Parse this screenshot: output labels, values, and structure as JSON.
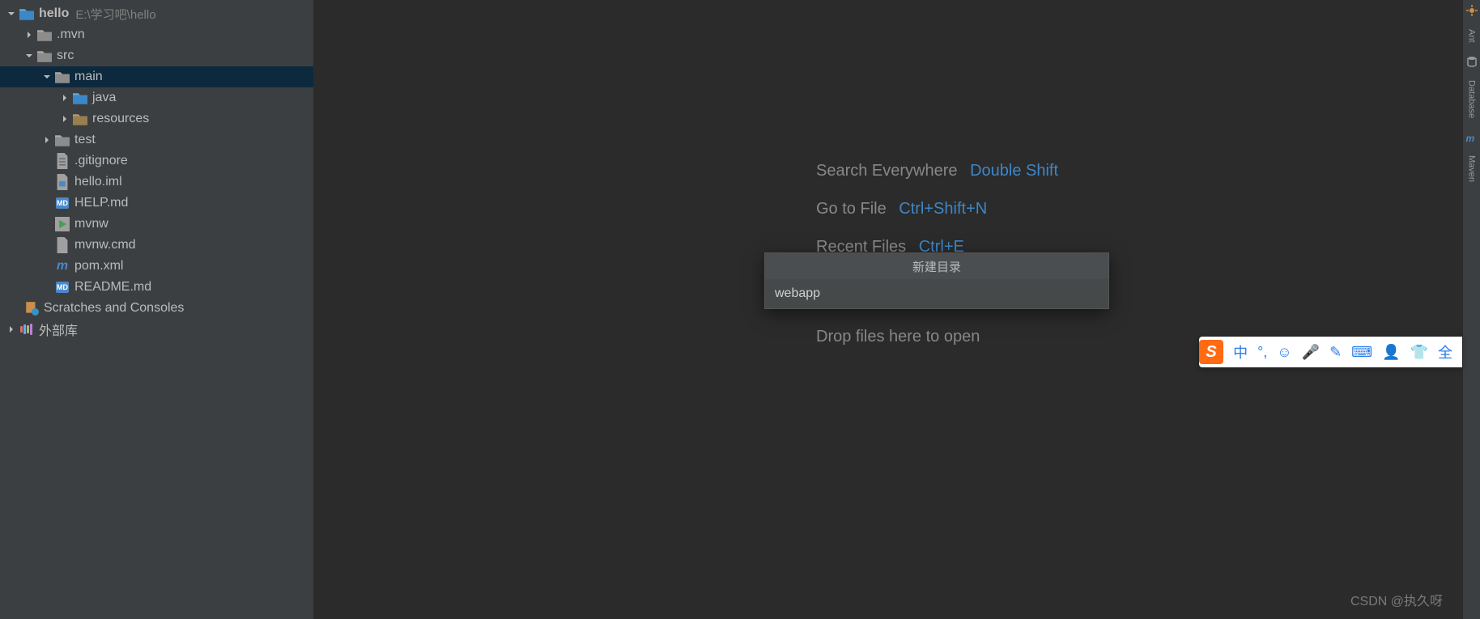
{
  "project": {
    "root": {
      "name": "hello",
      "path": "E:\\学习吧\\hello"
    },
    "nodes": {
      "mvn": ".mvn",
      "src": "src",
      "main": "main",
      "java": "java",
      "resources": "resources",
      "test": "test",
      "gitignore": ".gitignore",
      "helloiml": "hello.iml",
      "helpmd": "HELP.md",
      "mvnw": "mvnw",
      "mvnwcmd": "mvnw.cmd",
      "pomxml": "pom.xml",
      "readme": "README.md",
      "scratches": "Scratches and Consoles",
      "extlib": "外部库"
    }
  },
  "editor": {
    "hints": {
      "search": {
        "label": "Search Everywhere",
        "kbd": "Double Shift"
      },
      "gotofile": {
        "label": "Go to File",
        "kbd": "Ctrl+Shift+N"
      },
      "recent": {
        "label": "Recent Files",
        "kbd": "Ctrl+E"
      }
    },
    "drop": "Drop files here to open"
  },
  "dialog": {
    "title": "新建目录",
    "value": "webapp"
  },
  "rightbar": {
    "ant": "Ant",
    "database": "Database",
    "maven": "Maven"
  },
  "ime": {
    "lang": "中",
    "full": "全"
  },
  "watermark": "CSDN @执久呀"
}
